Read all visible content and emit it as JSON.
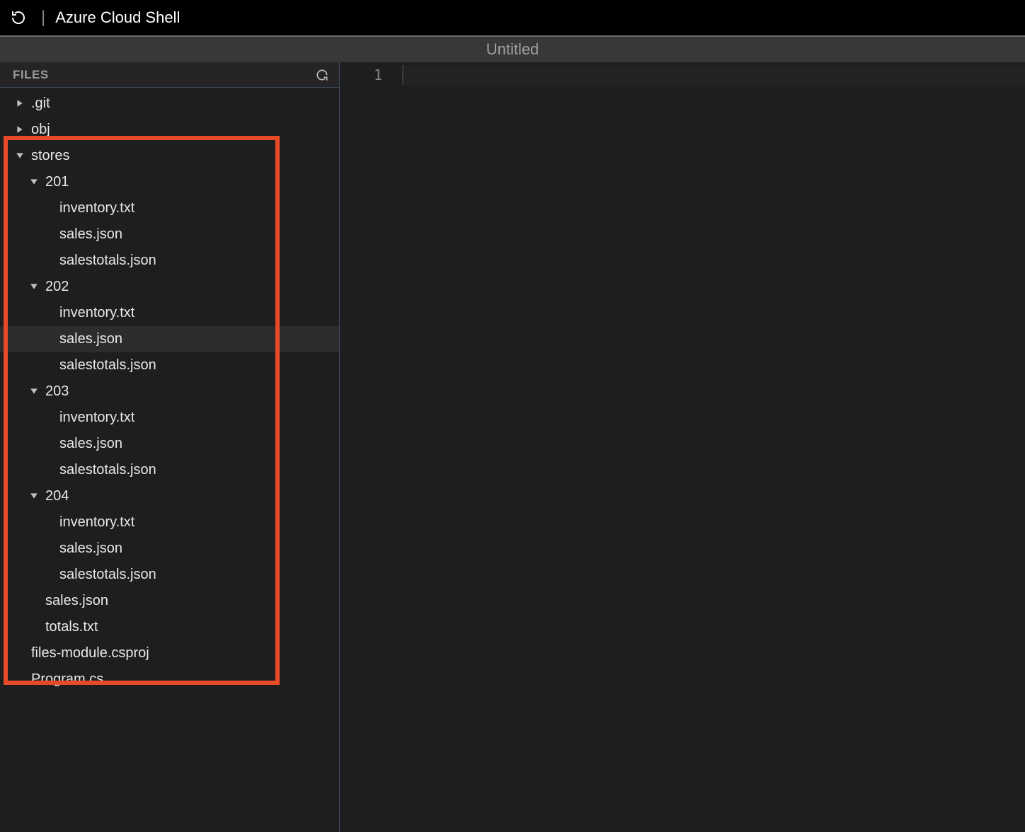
{
  "header": {
    "app_title": "Azure Cloud Shell"
  },
  "tab": {
    "label": "Untitled"
  },
  "sidebar": {
    "title": "FILES",
    "tree": [
      {
        "label": ".git",
        "depth": 0,
        "expanded": false,
        "isFolder": true,
        "selected": false
      },
      {
        "label": "obj",
        "depth": 0,
        "expanded": false,
        "isFolder": true,
        "selected": false
      },
      {
        "label": "stores",
        "depth": 0,
        "expanded": true,
        "isFolder": true,
        "selected": false
      },
      {
        "label": "201",
        "depth": 1,
        "expanded": true,
        "isFolder": true,
        "selected": false
      },
      {
        "label": "inventory.txt",
        "depth": 2,
        "expanded": false,
        "isFolder": false,
        "selected": false
      },
      {
        "label": "sales.json",
        "depth": 2,
        "expanded": false,
        "isFolder": false,
        "selected": false
      },
      {
        "label": "salestotals.json",
        "depth": 2,
        "expanded": false,
        "isFolder": false,
        "selected": false
      },
      {
        "label": "202",
        "depth": 1,
        "expanded": true,
        "isFolder": true,
        "selected": false
      },
      {
        "label": "inventory.txt",
        "depth": 2,
        "expanded": false,
        "isFolder": false,
        "selected": false
      },
      {
        "label": "sales.json",
        "depth": 2,
        "expanded": false,
        "isFolder": false,
        "selected": true
      },
      {
        "label": "salestotals.json",
        "depth": 2,
        "expanded": false,
        "isFolder": false,
        "selected": false
      },
      {
        "label": "203",
        "depth": 1,
        "expanded": true,
        "isFolder": true,
        "selected": false
      },
      {
        "label": "inventory.txt",
        "depth": 2,
        "expanded": false,
        "isFolder": false,
        "selected": false
      },
      {
        "label": "sales.json",
        "depth": 2,
        "expanded": false,
        "isFolder": false,
        "selected": false
      },
      {
        "label": "salestotals.json",
        "depth": 2,
        "expanded": false,
        "isFolder": false,
        "selected": false
      },
      {
        "label": "204",
        "depth": 1,
        "expanded": true,
        "isFolder": true,
        "selected": false
      },
      {
        "label": "inventory.txt",
        "depth": 2,
        "expanded": false,
        "isFolder": false,
        "selected": false
      },
      {
        "label": "sales.json",
        "depth": 2,
        "expanded": false,
        "isFolder": false,
        "selected": false
      },
      {
        "label": "salestotals.json",
        "depth": 2,
        "expanded": false,
        "isFolder": false,
        "selected": false
      },
      {
        "label": "sales.json",
        "depth": 1,
        "expanded": false,
        "isFolder": false,
        "selected": false
      },
      {
        "label": "totals.txt",
        "depth": 1,
        "expanded": false,
        "isFolder": false,
        "selected": false
      },
      {
        "label": "files-module.csproj",
        "depth": 0,
        "expanded": false,
        "isFolder": false,
        "selected": false
      },
      {
        "label": "Program.cs",
        "depth": 0,
        "expanded": false,
        "isFolder": false,
        "selected": false
      }
    ]
  },
  "editor": {
    "line_number": "1"
  }
}
